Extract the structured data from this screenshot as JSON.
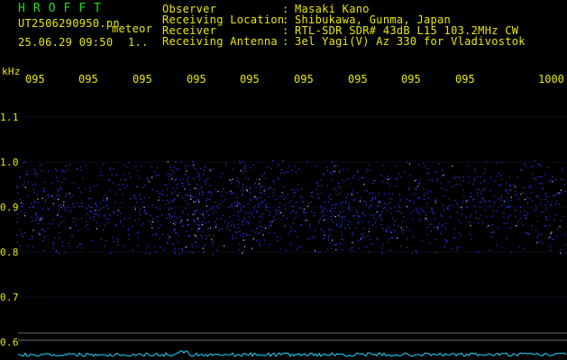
{
  "header": {
    "app_title": "HROFFT",
    "filename": "UT2506290950.pn",
    "mode": "meteor",
    "datetime": "25.06.29 09:50",
    "trunc": "1..",
    "rows": [
      {
        "label": "Observer",
        "colon": ":",
        "value": "Masaki Kano"
      },
      {
        "label": "Receiving Location",
        "colon": ":",
        "value": "Shibukawa, Gunma, Japan"
      },
      {
        "label": "Receiver",
        "colon": ":",
        "value": "RTL-SDR SDR# 43dB L15 103.2MHz CW"
      },
      {
        "label": "Receiving Antenna",
        "colon": ":",
        "value": "3el Yagi(V) Az 330 for Vladivostok"
      }
    ]
  },
  "axis": {
    "unit": "kHz",
    "x_ticks": [
      "095",
      "095",
      "095",
      "095",
      "095",
      "095",
      "095",
      "095",
      "095",
      "1000"
    ],
    "y_ticks": [
      "1.1",
      "1.0",
      "0.9",
      "0.8",
      "0.7",
      "0.6"
    ]
  },
  "colors": {
    "text": "#e8e800",
    "title": "#19e019",
    "signal": "#2a3cff",
    "trace": "#20d8ff",
    "grid": "#6d6d6d"
  }
}
